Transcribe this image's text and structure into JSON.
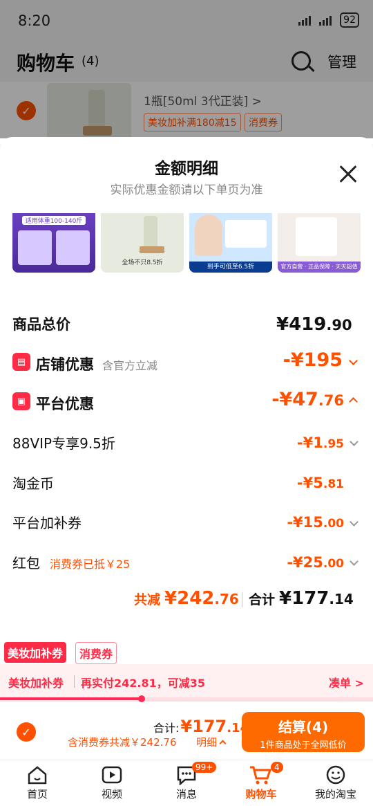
{
  "status_bar": {
    "time": "8:20",
    "battery": "92"
  },
  "header": {
    "title": "购物车",
    "count": "(4)",
    "manage": "管理"
  },
  "cart_item": {
    "spec": "1瓶[50ml 3代正装] >",
    "tag1": "美妆加补满180减15",
    "tag2": "消费券"
  },
  "sheet": {
    "title": "金额明细",
    "subtitle": "实际优惠金额请以下单页为准",
    "products": [
      {
        "caption": "适用体重100-140斤"
      },
      {
        "caption": "全场不只8.5折"
      },
      {
        "caption": "到手可低至6.5折"
      },
      {
        "caption": "官方自营 · 正品保障 · 天天超值"
      }
    ],
    "total": {
      "label": "商品总价",
      "yuan": "¥419",
      "fen": ".90"
    },
    "shop": {
      "label": "店铺优惠",
      "note": "含官方立减",
      "amount": "-¥195"
    },
    "platform": {
      "label": "平台优惠",
      "yuan": "-¥47",
      "fen": ".76"
    },
    "lines": [
      {
        "label": "88VIP专享9.5折",
        "yuan": "-¥1",
        "fen": ".95"
      },
      {
        "label": "淘金币",
        "yuan": "-¥5",
        "fen": ".81"
      },
      {
        "label": "平台加补券",
        "yuan": "-¥15",
        "fen": ".00"
      },
      {
        "label": "红包",
        "note": "消费券已抵￥25",
        "yuan": "-¥25",
        "fen": ".00"
      }
    ],
    "summary": {
      "saved_label": "共减",
      "saved_yuan": "¥242",
      "saved_fen": ".76",
      "total_label": "合计",
      "total_yuan": "¥177",
      "total_fen": ".14"
    }
  },
  "promo": {
    "tag1": "美妆加补券",
    "tag2": "消费券",
    "bar_label": "美妆加补券",
    "bar_text": "再实付242.81，可减35",
    "bar_link": "凑单 >",
    "progress": 0.38
  },
  "checkout": {
    "total_label": "合计:",
    "total_yuan": "¥177",
    "total_fen": ".14",
    "discount": "含消费券共减￥242.76",
    "detail": "明细",
    "button": "结算(4)",
    "button_sub": "1件商品处于全网低价"
  },
  "tabs": [
    {
      "label": "首页",
      "icon": "home-icon"
    },
    {
      "label": "视频",
      "icon": "video-icon"
    },
    {
      "label": "消息",
      "icon": "message-icon",
      "badge": "99+"
    },
    {
      "label": "购物车",
      "icon": "cart-icon",
      "badge": "4",
      "active": true
    },
    {
      "label": "我的淘宝",
      "icon": "profile-icon"
    }
  ],
  "colors": {
    "accent": "#ff5000",
    "red": "#ff2a45"
  }
}
